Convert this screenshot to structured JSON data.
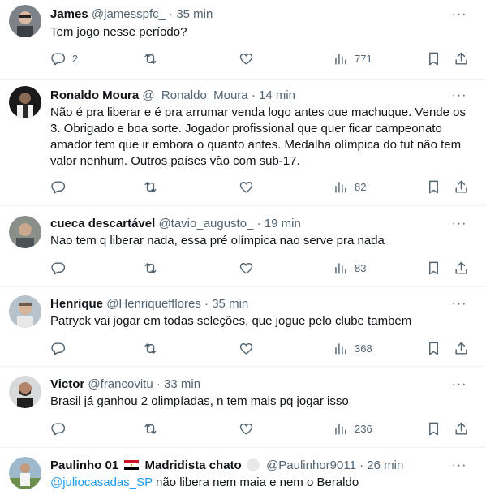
{
  "tweets": [
    {
      "name": "James",
      "handle": "@jamesspfc_",
      "dot": "·",
      "time": "35 min",
      "text": "Tem jogo nesse período?",
      "replies": "2",
      "retweets": "",
      "likes": "",
      "views": "771"
    },
    {
      "name": "Ronaldo Moura",
      "handle": "@_Ronaldo_Moura",
      "dot": "·",
      "time": "14 min",
      "text": "Não é pra liberar e é pra arrumar venda logo antes que machuque. Vende os 3. Obrigado e boa sorte. Jogador profissional que quer ficar campeonato amador tem que ir embora o quanto antes. Medalha olímpica do fut não tem valor nenhum. Outros países vão com sub-17.",
      "replies": "",
      "retweets": "",
      "likes": "",
      "views": "82"
    },
    {
      "name": "cueca descartável",
      "handle": "@tavio_augusto_",
      "dot": "·",
      "time": "19 min",
      "text": "Nao tem q liberar nada, essa pré olímpica nao serve pra nada",
      "replies": "",
      "retweets": "",
      "likes": "",
      "views": "83"
    },
    {
      "name": "Henrique",
      "handle": "@Henriquefflores",
      "dot": "·",
      "time": "35 min",
      "text": "Patryck vai jogar em todas seleções, que jogue pelo clube também",
      "replies": "",
      "retweets": "",
      "likes": "",
      "views": "368"
    },
    {
      "name": "Victor",
      "handle": "@francovitu",
      "dot": "·",
      "time": "33 min",
      "text": "Brasil já ganhou 2 olimpíadas, n tem mais pq jogar isso",
      "replies": "",
      "retweets": "",
      "likes": "",
      "views": "236"
    },
    {
      "name_part1": "Paulinho 01",
      "name_part2": "Madridista chato",
      "handle": "@Paulinhor9011",
      "dot": "·",
      "time": "26 min",
      "mention": "@juliocasadas_SP",
      "text": " não libera nem maia e nem o Beraldo"
    }
  ],
  "more_glyph": "···",
  "colors": {
    "text": "#0f1419",
    "secondary": "#536471",
    "link": "#1d9bf0",
    "divider": "#eff3f4"
  },
  "icons": [
    "reply-icon",
    "retweet-icon",
    "like-icon",
    "views-icon",
    "bookmark-icon",
    "share-icon",
    "more-icon",
    "egypt-flag-icon"
  ]
}
